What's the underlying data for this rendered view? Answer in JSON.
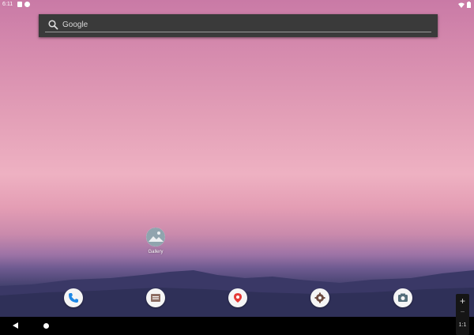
{
  "status_bar": {
    "time": "6:11"
  },
  "search": {
    "text": "Google",
    "icon": "search-icon"
  },
  "home": {
    "apps": [
      {
        "label": "Gallery",
        "icon": "gallery-icon"
      }
    ]
  },
  "dock": {
    "icons": [
      "phone-icon",
      "messages-icon",
      "maps-icon",
      "settings-icon",
      "camera-icon"
    ]
  },
  "nav": {
    "back": "back-icon",
    "home": "home-icon"
  },
  "zoom": {
    "plus": "+",
    "minus": "−",
    "reset": "1:1"
  },
  "colors": {
    "search_bg": "#3a3a3a",
    "accent_maps": "#e53935",
    "gallery_blue": "#90a4ae"
  }
}
